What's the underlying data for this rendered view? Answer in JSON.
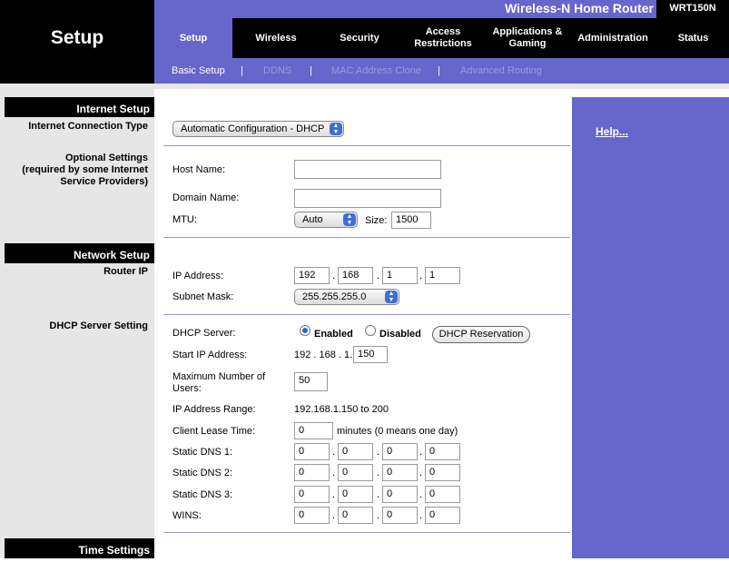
{
  "header": {
    "section_title": "Setup",
    "product_name": "Wireless-N Home Router",
    "model": "WRT150N",
    "tabs": [
      {
        "label": "Setup",
        "active": true
      },
      {
        "label": "Wireless"
      },
      {
        "label": "Security"
      },
      {
        "label": "Access\nRestrictions"
      },
      {
        "label": "Applications &\nGaming"
      },
      {
        "label": "Administration"
      },
      {
        "label": "Status"
      }
    ],
    "subtabs": [
      {
        "label": "Basic Setup",
        "active": true
      },
      {
        "label": "DDNS"
      },
      {
        "label": "MAC Address Clone"
      },
      {
        "label": "Advanced Routing"
      }
    ],
    "separator": "|"
  },
  "left": {
    "internet_setup": "Internet Setup",
    "internet_connection_type": "Internet Connection Type",
    "optional_settings": "Optional Settings\n(required by some Internet\nService Providers)",
    "network_setup": "Network Setup",
    "router_ip": "Router IP",
    "dhcp_server_setting": "DHCP Server Setting",
    "time_settings": "Time Settings"
  },
  "form": {
    "connection_type": "Automatic Configuration - DHCP",
    "host_name_label": "Host Name:",
    "host_name": "",
    "domain_name_label": "Domain Name:",
    "domain_name": "",
    "mtu_label": "MTU:",
    "mtu_mode": "Auto",
    "size_label": "Size:",
    "mtu_size": "1500",
    "ip_address_label": "IP Address:",
    "ip": [
      "192",
      "168",
      "1",
      "1"
    ],
    "subnet_mask_label": "Subnet Mask:",
    "subnet_mask": "255.255.255.0",
    "dhcp_server_label": "DHCP Server:",
    "enabled_label": "Enabled",
    "disabled_label": "Disabled",
    "dhcp_enabled": true,
    "dhcp_reservation": "DHCP Reservation",
    "start_ip_label": "Start IP Address:",
    "start_ip_prefix": "192 . 168 . 1.",
    "start_ip_last": "150",
    "max_users_label": "Maximum Number of\nUsers:",
    "max_users": "50",
    "ip_range_label": "IP Address Range:",
    "ip_range": "192.168.1.150 to 200",
    "lease_time_label": "Client Lease Time:",
    "lease_time": "0",
    "lease_time_unit": "minutes (0 means one day)",
    "dns1_label": "Static DNS 1:",
    "dns1": [
      "0",
      "0",
      "0",
      "0"
    ],
    "dns2_label": "Static DNS 2:",
    "dns2": [
      "0",
      "0",
      "0",
      "0"
    ],
    "dns3_label": "Static DNS 3:",
    "dns3": [
      "0",
      "0",
      "0",
      "0"
    ],
    "wins_label": "WINS:",
    "wins": [
      "0",
      "0",
      "0",
      "0"
    ],
    "dot": "."
  },
  "help": {
    "label": "Help..."
  },
  "colors": {
    "accent": "#6666cc",
    "dark": "#000000",
    "panel": "#e6e6e6"
  }
}
